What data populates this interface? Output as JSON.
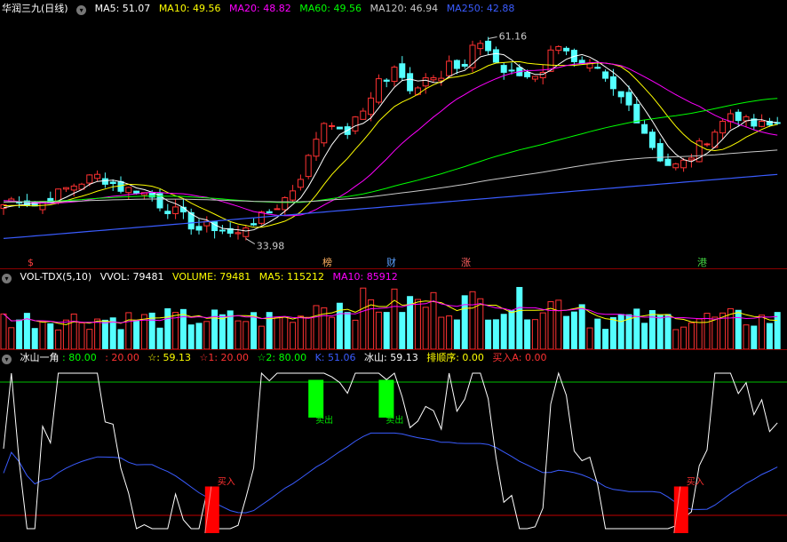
{
  "header_main": {
    "title": "华润三九(日线)",
    "ma5": "MA5: 51.07",
    "ma10": "MA10: 49.56",
    "ma20": "MA20: 48.82",
    "ma60": "MA60: 49.56",
    "ma120": "MA120: 46.94",
    "ma250": "MA250: 42.88"
  },
  "header_vol": {
    "name": "VOL-TDX(5,10)",
    "vvol": "VVOL: 79481",
    "volume": "VOLUME: 79481",
    "ma5": "MA5: 115212",
    "ma10": "MA10: 85912"
  },
  "header_ind": {
    "name": "冰山一角",
    "v1": ": 80.00",
    "v2": ": 20.00",
    "v3": "☆: 59.13",
    "v4": "☆1: 20.00",
    "v5": "☆2: 80.00",
    "v6": "K: 51.06",
    "v7": "冰山: 59.13",
    "v8": "排顺序: 0.00",
    "v9": "买入A: 0.00"
  },
  "annotations": {
    "high": "61.16",
    "low": "33.98",
    "buy": "买入",
    "sell": "卖出"
  },
  "event_markers": [
    "$",
    "榜",
    "财",
    "涨",
    "港"
  ],
  "colors": {
    "up": "#ff3232",
    "down": "#54ffff",
    "ma5": "#ffffff",
    "ma10": "#ffff00",
    "ma20": "#ff00ff",
    "ma60": "#00ff00",
    "ma120": "#c8c8c8",
    "ma250": "#3a5cff",
    "k_line": "#3a5cff",
    "iceberg_line": "#ffffff",
    "buy_bar": "#ff0000",
    "sell_bar": "#00ff00"
  },
  "chart_data": [
    {
      "type": "candlestick",
      "panel": "price",
      "ylim": [
        32,
        64
      ],
      "high_label_value": 61.16,
      "low_label_value": 33.98,
      "anchor_prices": [
        38.6,
        39.4,
        39.6,
        38.3,
        38.9,
        39.6,
        40.2,
        41.0,
        41.5,
        42.1,
        42.5,
        42.0,
        41.3,
        40.5,
        40.9,
        40.2,
        39.6,
        38.4,
        37.9,
        37.2,
        36.0,
        35.2,
        35.7,
        35.5,
        34.8,
        34.3,
        35.8,
        36.5,
        37.0,
        38.1,
        39.2,
        40.7,
        42.9,
        45.7,
        49.5,
        50.5,
        48.2,
        48.6,
        50.4,
        52.1,
        55.6,
        55.4,
        57.0,
        55.2,
        54.3,
        55.7,
        56.5,
        56.5,
        58.7,
        55.7,
        58.9,
        61.0,
        59.6,
        57.6,
        56.2,
        56.3,
        56.0,
        56.4,
        57.1,
        60.2,
        61.1,
        57.7,
        57.2,
        57.1,
        56.2,
        54.4,
        53.3,
        52.2,
        50.3,
        48.0,
        45.6,
        44.2,
        43.8,
        44.3,
        45.6,
        47.1,
        48.3,
        49.6,
        51.1,
        50.6,
        49.3,
        49.4,
        49.2,
        49.7
      ]
    },
    {
      "type": "bar",
      "panel": "volume",
      "series": [
        {
          "name": "VOLUME",
          "values": [
            79481
          ]
        },
        {
          "name": "MA5",
          "values": [
            115212
          ]
        },
        {
          "name": "MA10",
          "values": [
            85912
          ]
        }
      ]
    },
    {
      "type": "line",
      "panel": "indicator",
      "ylim": [
        10,
        90
      ],
      "reference_lines": [
        80,
        20
      ],
      "series": [
        {
          "name": "冰山",
          "last": 59.13
        },
        {
          "name": "K",
          "last": 51.06
        }
      ]
    }
  ]
}
